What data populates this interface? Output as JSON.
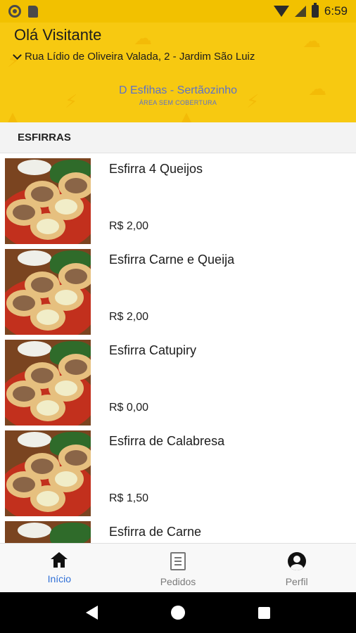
{
  "status_bar": {
    "time": "6:59"
  },
  "header": {
    "greeting": "Olá Visitante",
    "address": "Rua Lídio de Oliveira Valada, 2 - Jardim São Luiz",
    "store_name": "D Esfihas - Sertãozinho",
    "coverage_note": "ÁREA SEM COBERTURA"
  },
  "category": {
    "title": "ESFIRRAS"
  },
  "products": [
    {
      "name": "Esfirra 4 Queijos",
      "price": "R$ 2,00"
    },
    {
      "name": "Esfirra Carne e Queija",
      "price": "R$ 2,00"
    },
    {
      "name": "Esfirra Catupiry",
      "price": "R$ 0,00"
    },
    {
      "name": "Esfirra de Calabresa",
      "price": "R$ 1,50"
    },
    {
      "name": "Esfirra de Carne",
      "price": ""
    }
  ],
  "bottom_nav": {
    "home": "Início",
    "orders": "Pedidos",
    "profile": "Perfil"
  },
  "colors": {
    "header_yellow": "#f7c911",
    "active_blue": "#2f6fd6",
    "store_text_blue": "#5d72c8"
  }
}
